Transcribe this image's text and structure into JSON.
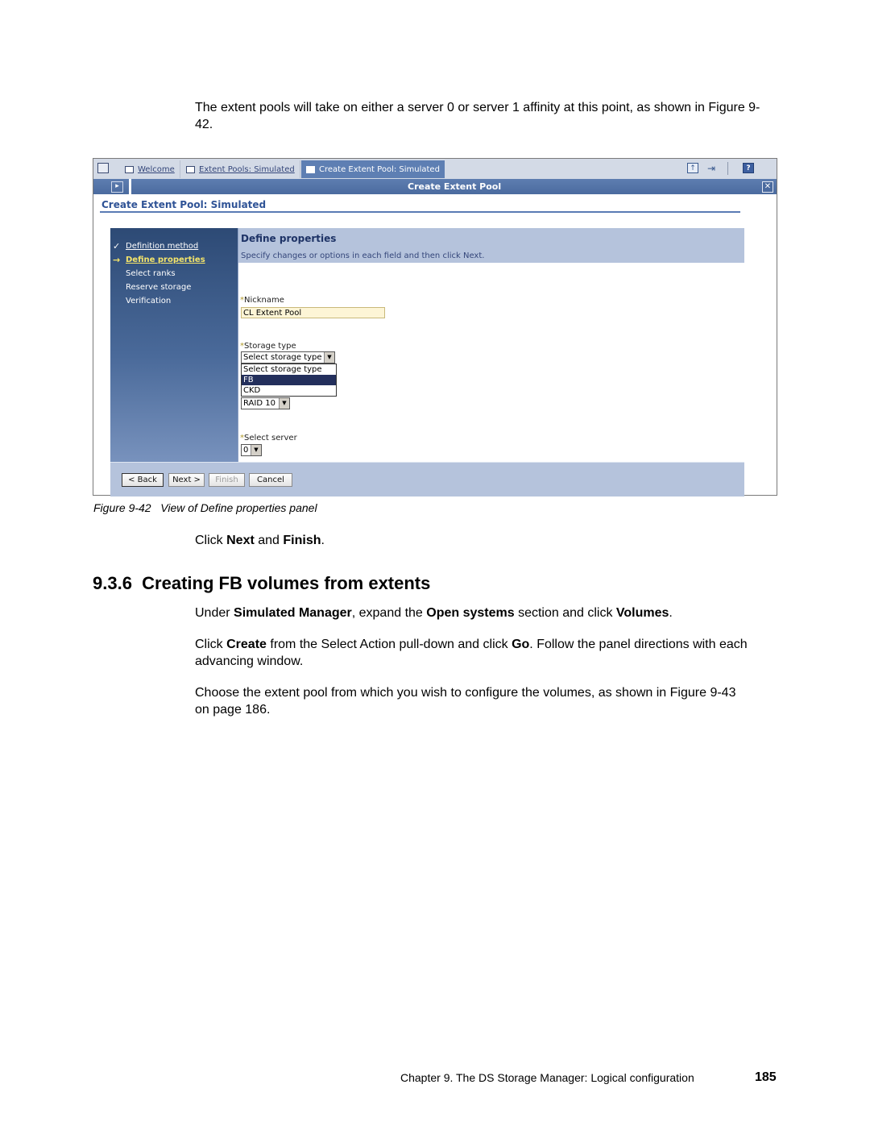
{
  "intro_paragraph": "The extent pools will take on either a server 0 or server 1 affinity at this point, as shown in Figure 9-42.",
  "screenshot": {
    "tabs": [
      {
        "label": "Welcome",
        "icon": "window-icon",
        "active": false
      },
      {
        "label": "Extent Pools: Simulated",
        "icon": "window-icon",
        "active": false
      },
      {
        "label": "Create Extent Pool: Simulated",
        "icon": "window-icon",
        "active": true
      }
    ],
    "toolbar_icons": [
      "minimize-icon",
      "logout-icon",
      "help-icon"
    ],
    "help_label": "?",
    "titlebar_title": "Create Extent Pool",
    "page_title": "Create Extent Pool: Simulated",
    "wizard_steps": [
      {
        "label": "Definition method",
        "state": "done",
        "marker": "✓"
      },
      {
        "label": "Define properties",
        "state": "current",
        "marker": "→"
      },
      {
        "label": "Select ranks",
        "state": "pending",
        "marker": ""
      },
      {
        "label": "Reserve storage",
        "state": "pending",
        "marker": ""
      },
      {
        "label": "Verification",
        "state": "pending",
        "marker": ""
      }
    ],
    "panel_heading": "Define properties",
    "panel_instructions": "Specify changes or options in each field and then click Next.",
    "fields": {
      "nickname": {
        "label": "Nickname",
        "required_marker": "*",
        "value": "CL Extent Pool"
      },
      "storage_type": {
        "label": "Storage type",
        "required_marker": "*",
        "selected": "Select storage type",
        "options": [
          "Select storage type",
          "FB",
          "CKD"
        ],
        "highlighted_option": "FB"
      },
      "raid_type": {
        "selected": "RAID 10"
      },
      "server": {
        "label": "Select server",
        "required_marker": "*",
        "selected": "0"
      }
    },
    "buttons": {
      "back": "< Back",
      "next": "Next >",
      "finish": "Finish",
      "cancel": "Cancel"
    }
  },
  "figure_caption": "Figure 9-42   View of Define properties panel",
  "para_click_next": {
    "pre": "Click ",
    "b1": "Next",
    "mid": " and ",
    "b2": "Finish",
    "post": "."
  },
  "section": {
    "number": "9.3.6",
    "title": "Creating FB volumes from extents"
  },
  "para_under": {
    "t1": "Under ",
    "b1": "Simulated Manager",
    "t2": ", expand the ",
    "b2": "Open systems",
    "t3": " section and click ",
    "b3": "Volumes",
    "t4": "."
  },
  "para_click_create": {
    "t1": "Click ",
    "b1": "Create",
    "t2": " from the Select Action pull-down and click ",
    "b2": "Go",
    "t3": ". Follow the panel directions with each advancing window."
  },
  "para_choose": "Choose the extent pool from which you wish to configure the volumes, as shown in Figure 9-43 on page 186.",
  "page_footer": {
    "chapter": "Chapter 9. The DS Storage Manager: Logical configuration",
    "page_number": "185"
  }
}
